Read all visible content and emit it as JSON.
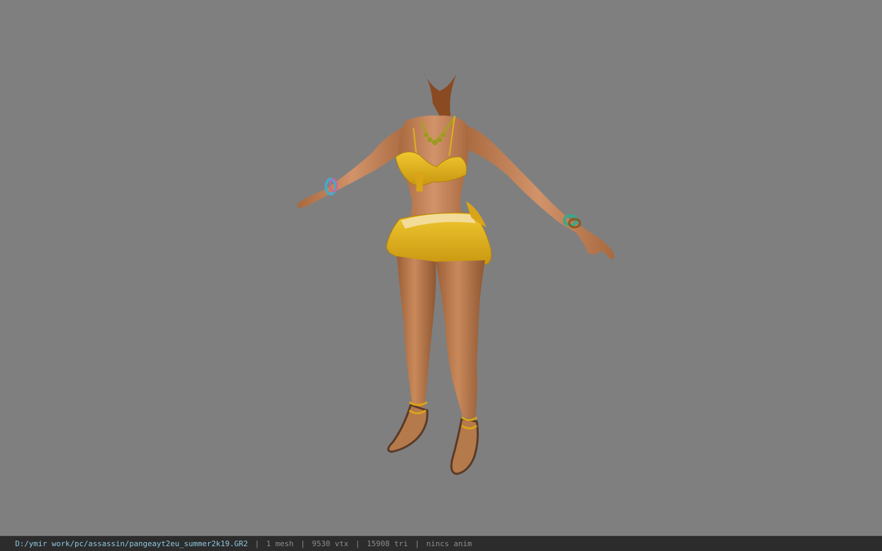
{
  "viewport": {
    "background": "#7f7f7f",
    "model_description_icon": "character-model-preview"
  },
  "statusbar": {
    "file_path": "D:/ymir work/pc/assassin/pangeayt2eu_summer2k19.GR2",
    "separator": "|",
    "mesh_count": "1 mesh",
    "vertex_count": "9530 vtx",
    "triangle_count": "15908 tri",
    "anim_status": "nincs anim"
  },
  "colors": {
    "skin": "#c9895a",
    "skin_shadow": "#9a5f38",
    "outfit": "#e0b020",
    "outfit_dark": "#b58710",
    "statusbar_bg": "#2c2c2c",
    "path_text": "#8fc8e0"
  }
}
